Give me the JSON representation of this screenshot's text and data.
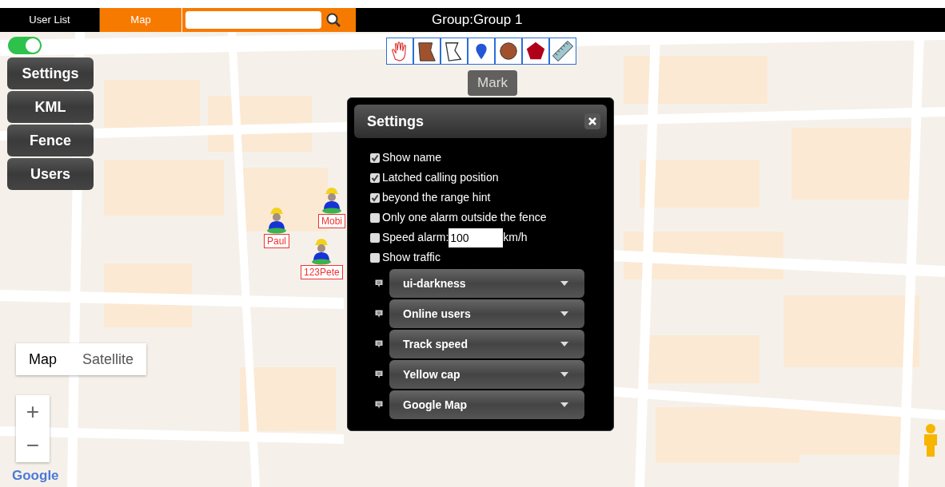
{
  "top_bar": {
    "tabs": [
      {
        "label": "User List",
        "selected": false
      },
      {
        "label": "Map",
        "selected": true
      }
    ],
    "group": "Group:Group 1"
  },
  "map": {
    "toggle": {
      "on": true
    },
    "side_menu": [
      "Settings",
      "KML",
      "Fence",
      "Users"
    ],
    "tools": [
      {
        "kind": "hand"
      },
      {
        "kind": "polygon"
      },
      {
        "kind": "outline"
      },
      {
        "kind": "pin"
      },
      {
        "kind": "circle"
      },
      {
        "kind": "pentagon"
      },
      {
        "kind": "ruler"
      }
    ],
    "tooltip": "Mark",
    "markers": [
      {
        "label": "Mobi"
      },
      {
        "label": "Paul"
      },
      {
        "label": "123Pete"
      }
    ],
    "map_types": [
      {
        "label": "Map",
        "selected": true
      },
      {
        "label": "Satellite",
        "selected": false
      }
    ],
    "zoom": [
      "+",
      "−"
    ],
    "logo": "Google"
  },
  "settings_dialog": {
    "title": "Settings",
    "options": [
      {
        "kind": "checkbox",
        "label": "Show name",
        "checked": true
      },
      {
        "kind": "checkbox",
        "label": "Latched calling position",
        "checked": true
      },
      {
        "kind": "checkbox",
        "label": "beyond the range hint",
        "checked": true
      },
      {
        "kind": "checkbox",
        "label": "Only one alarm outside the fence",
        "checked": false
      },
      {
        "kind": "speed",
        "label": "Speed alarm:",
        "checked": false,
        "value": "100",
        "unit": "km/h"
      },
      {
        "kind": "checkbox",
        "label": "Show traffic",
        "checked": false
      }
    ],
    "selects": [
      "ui-darkness",
      "Online users",
      "Track speed",
      "Yellow cap",
      "Google Map"
    ]
  }
}
